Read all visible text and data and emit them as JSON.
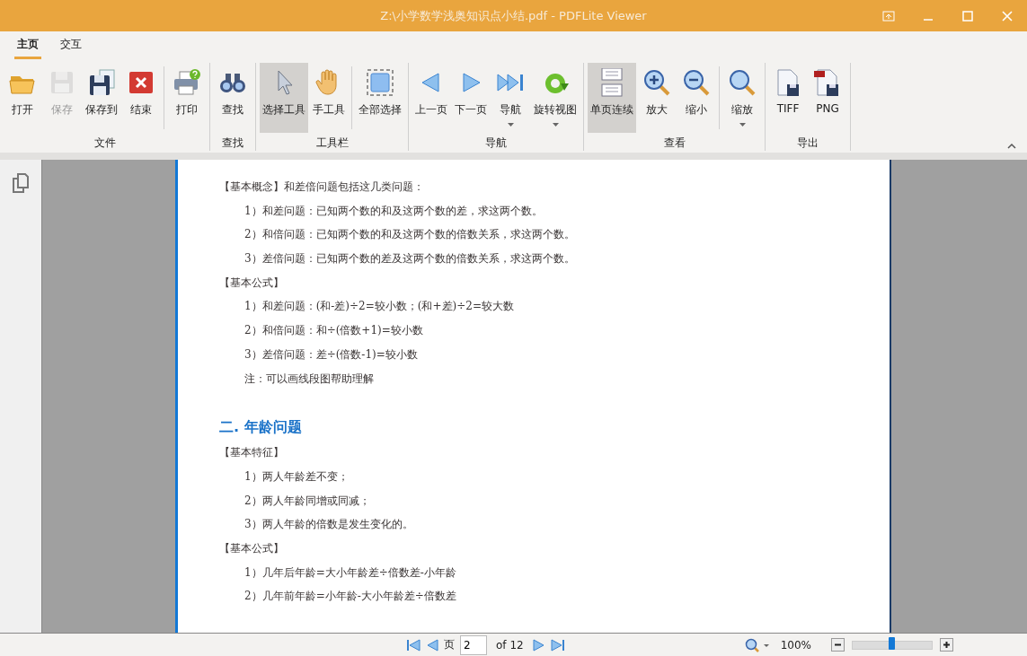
{
  "window": {
    "title": "Z:\\小学数学浅奥知识点小结.pdf - PDFLite Viewer"
  },
  "tabs": [
    {
      "label": "主页",
      "selected": true
    },
    {
      "label": "交互",
      "selected": false
    }
  ],
  "ribbon": [
    {
      "label": "文件",
      "buttons": [
        {
          "kind": "button",
          "label": "打开",
          "selected": false,
          "disabled": false
        },
        {
          "kind": "button",
          "label": "保存",
          "selected": false,
          "disabled": true
        },
        {
          "kind": "button",
          "label": "保存到",
          "selected": false,
          "disabled": false
        },
        {
          "kind": "button",
          "label": "结束",
          "selected": false,
          "disabled": false
        },
        {
          "kind": "separator"
        },
        {
          "kind": "button",
          "label": "打印",
          "selected": false,
          "disabled": false
        }
      ]
    },
    {
      "label": "查找",
      "buttons": [
        {
          "kind": "button",
          "label": "查找",
          "selected": false,
          "disabled": false
        }
      ]
    },
    {
      "label": "工具栏",
      "buttons": [
        {
          "kind": "button",
          "label": "选择工具",
          "selected": true,
          "disabled": false
        },
        {
          "kind": "button",
          "label": "手工具",
          "selected": false,
          "disabled": false
        },
        {
          "kind": "separator"
        },
        {
          "kind": "button",
          "label": "全部选择",
          "selected": false,
          "disabled": false
        }
      ]
    },
    {
      "label": "导航",
      "buttons": [
        {
          "kind": "button",
          "label": "上一页",
          "selected": false,
          "disabled": false
        },
        {
          "kind": "button",
          "label": "下一页",
          "selected": false,
          "disabled": false
        },
        {
          "kind": "dropdown",
          "label": "导航",
          "selected": false,
          "disabled": false
        },
        {
          "kind": "dropdown",
          "label": "旋转视图",
          "selected": false,
          "disabled": false
        }
      ]
    },
    {
      "label": "查看",
      "buttons": [
        {
          "kind": "button",
          "label": "单页连续",
          "selected": true,
          "disabled": false
        },
        {
          "kind": "button",
          "label": "放大",
          "selected": false,
          "disabled": false
        },
        {
          "kind": "button",
          "label": "缩小",
          "selected": false,
          "disabled": false
        },
        {
          "kind": "separator"
        },
        {
          "kind": "dropdown",
          "label": "缩放",
          "selected": false,
          "disabled": false
        }
      ]
    },
    {
      "label": "导出",
      "buttons": [
        {
          "kind": "button",
          "label": "TIFF",
          "selected": false,
          "disabled": false
        },
        {
          "kind": "button",
          "label": "PNG",
          "selected": false,
          "disabled": false
        }
      ]
    }
  ],
  "document": {
    "lines": [
      {
        "kind": "label",
        "text": "【基本概念】和差倍问题包括这几类问题："
      },
      {
        "kind": "item",
        "text": "1）和差问题：已知两个数的和及这两个数的差，求这两个数。"
      },
      {
        "kind": "item",
        "text": "2）和倍问题：已知两个数的和及这两个数的倍数关系，求这两个数。"
      },
      {
        "kind": "item",
        "text": "3）差倍问题：已知两个数的差及这两个数的倍数关系，求这两个数。"
      },
      {
        "kind": "label",
        "text": "【基本公式】"
      },
      {
        "kind": "item",
        "text": "1）和差问题：(和-差)÷2=较小数；(和+差)÷2=较大数"
      },
      {
        "kind": "item",
        "text": "2）和倍问题：和÷(倍数+1)=较小数"
      },
      {
        "kind": "item",
        "text": "3）差倍问题：差÷(倍数-1)=较小数"
      },
      {
        "kind": "item",
        "text": "注：可以画线段图帮助理解"
      },
      {
        "kind": "heading",
        "text": "二. 年龄问题"
      },
      {
        "kind": "label",
        "text": "【基本特征】"
      },
      {
        "kind": "item",
        "text": "1）两人年龄差不变；"
      },
      {
        "kind": "item",
        "text": "2）两人年龄同增或同减；"
      },
      {
        "kind": "item",
        "text": "3）两人年龄的倍数是发生变化的。"
      },
      {
        "kind": "label",
        "text": "【基本公式】"
      },
      {
        "kind": "item",
        "text": "1）几年后年龄=大小年龄差÷倍数差-小年龄"
      },
      {
        "kind": "item",
        "text": "2）几年前年龄=小年龄-大小年龄差÷倍数差"
      }
    ]
  },
  "status_bar": {
    "page_label": "页",
    "page": "2",
    "page_count": "of 12",
    "zoom": "100%",
    "zoom_slider": {
      "level": 0.5
    }
  }
}
